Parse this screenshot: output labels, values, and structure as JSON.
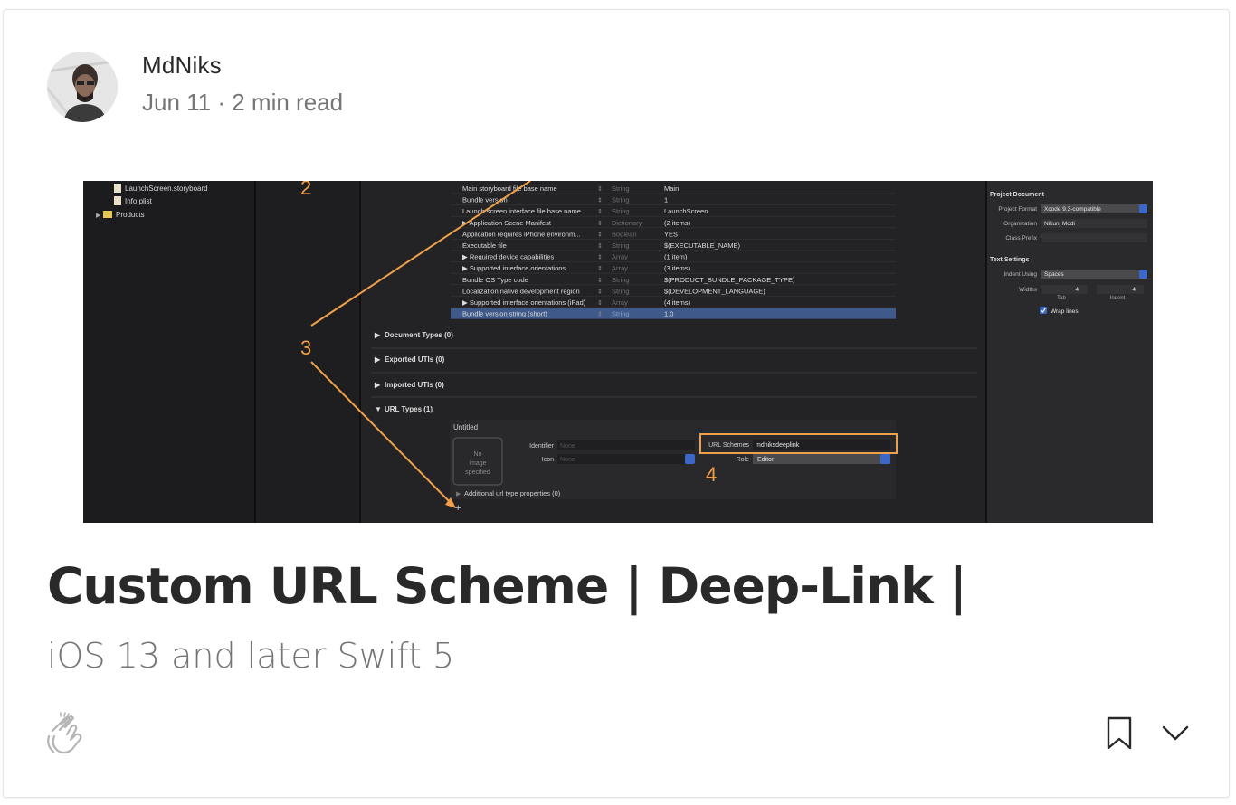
{
  "author": {
    "name": "MdNiks",
    "meta": "Jun 11 · 2 min read",
    "avatar_icon": "author-avatar"
  },
  "article": {
    "title": "Custom URL Scheme | Deep-Link |",
    "subtitle": "iOS 13 and later Swift 5"
  },
  "hero": {
    "sidebar": {
      "file1": "LaunchScreen.storyboard",
      "file2": "Info.plist",
      "folder": "Products"
    },
    "plist_rows": [
      {
        "key": "Main storyboard file base name",
        "type": "String",
        "value": "Main"
      },
      {
        "key": "Bundle version",
        "type": "String",
        "value": "1"
      },
      {
        "key": "Launch screen interface file base name",
        "type": "String",
        "value": "LaunchScreen"
      },
      {
        "key": "▶ Application Scene Manifest",
        "type": "Dictionary",
        "value": "(2 items)"
      },
      {
        "key": "Application requires iPhone environm...",
        "type": "Boolean",
        "value": "YES"
      },
      {
        "key": "Executable file",
        "type": "String",
        "value": "$(EXECUTABLE_NAME)"
      },
      {
        "key": "▶ Required device capabilities",
        "type": "Array",
        "value": "(1 item)"
      },
      {
        "key": "▶ Supported interface orientations",
        "type": "Array",
        "value": "(3 items)"
      },
      {
        "key": "Bundle OS Type code",
        "type": "String",
        "value": "$(PRODUCT_BUNDLE_PACKAGE_TYPE)"
      },
      {
        "key": "Localization native development region",
        "type": "String",
        "value": "$(DEVELOPMENT_LANGUAGE)"
      },
      {
        "key": "▶ Supported interface orientations (iPad)",
        "type": "Array",
        "value": "(4 items)"
      },
      {
        "key": "Bundle version string (short)",
        "type": "String",
        "value": "1.0"
      }
    ],
    "sections": {
      "doc_types": "Document Types (0)",
      "exported": "Exported UTIs (0)",
      "imported": "Imported UTIs (0)",
      "url_types": "URL Types (1)"
    },
    "url_type": {
      "untitled": "Untitled",
      "no_image_1": "No",
      "no_image_2": "image",
      "no_image_3": "specified",
      "identifier_label": "Identifier",
      "identifier_placeholder": "None",
      "icon_label": "Icon",
      "icon_placeholder": "None",
      "schemes_label": "URL Schemes",
      "schemes_value": "mdniksdeeplink",
      "role_label": "Role",
      "role_value": "Editor",
      "additional": "Additional url type properties (0)",
      "plus": "+"
    },
    "inspector": {
      "project_document": "Project Document",
      "project_format_label": "Project Format",
      "project_format_value": "Xcode 9.3-compatible",
      "organization_label": "Organization",
      "organization_value": "Nikunj Modi",
      "class_prefix_label": "Class Prefix",
      "text_settings": "Text Settings",
      "indent_using_label": "Indent Using",
      "indent_using_value": "Spaces",
      "widths_label": "Widths",
      "tab_value": "4",
      "indent_value": "4",
      "tab_label": "Tab",
      "indent_label": "Indent",
      "wrap_lines": "Wrap lines"
    },
    "annotations": {
      "n2": "2",
      "n3": "3",
      "n4": "4"
    },
    "colors": {
      "accent": "#f0a04b",
      "selection": "#3f5a8a",
      "bg": "#1f1f21"
    }
  },
  "actions": {
    "clap_icon": "clap-icon",
    "bookmark_icon": "bookmark-icon",
    "more_icon": "chevron-down-icon"
  }
}
